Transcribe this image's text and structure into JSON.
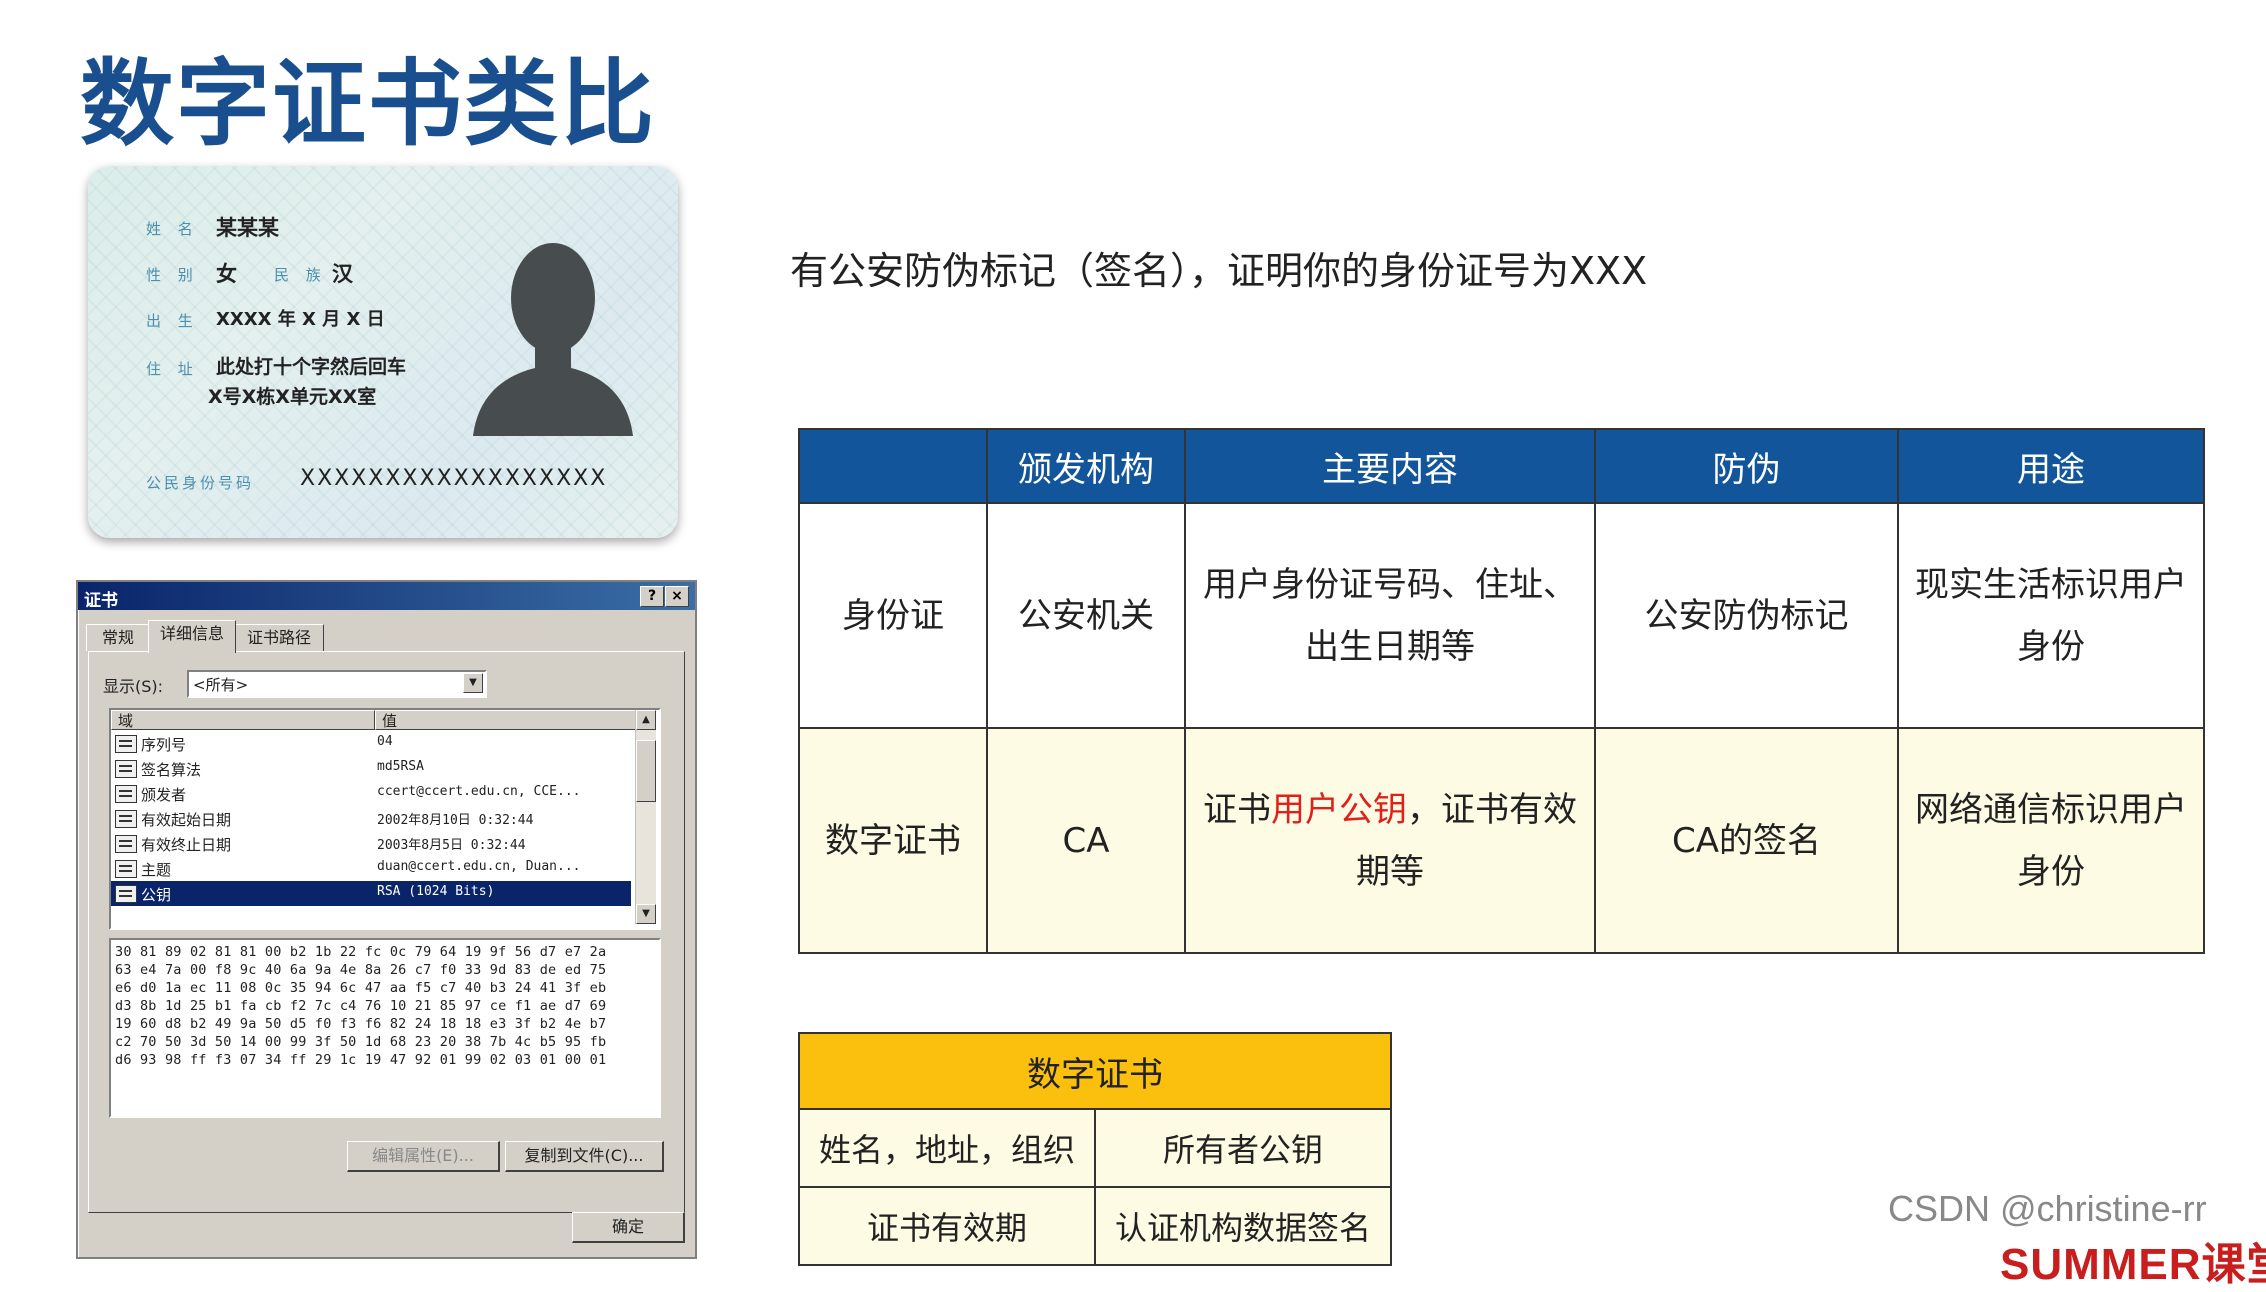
{
  "title": "数字证书类比",
  "id_card": {
    "name_label": "姓 名",
    "name_value": "某某某",
    "gender_label": "性 别",
    "gender_value": "女",
    "ethnicity_label": "民 族",
    "ethnicity_value": "汉",
    "birth_label": "出 生",
    "birth_value": "XXXX 年 X 月 X 日",
    "address_label": "住 址",
    "address_line1": "此处打十个字然后回车",
    "address_line2": "X号X栋X单元XX室",
    "id_number_label": "公民身份号码",
    "id_number_value": "XXXXXXXXXXXXXXXXXX"
  },
  "cert_dialog": {
    "title": "证书",
    "help_btn": "?",
    "close_btn": "×",
    "tabs": [
      "常规",
      "详细信息",
      "证书路径"
    ],
    "show_label": "显示(S):",
    "show_value": "<所有>",
    "col_field": "域",
    "col_value": "值",
    "rows": [
      {
        "field": "序列号",
        "value": "04"
      },
      {
        "field": "签名算法",
        "value": "md5RSA"
      },
      {
        "field": "颁发者",
        "value": "ccert@ccert.edu.cn, CCE..."
      },
      {
        "field": "有效起始日期",
        "value": "2002年8月10日 0:32:44"
      },
      {
        "field": "有效终止日期",
        "value": "2003年8月5日 0:32:44"
      },
      {
        "field": "主题",
        "value": "duan@ccert.edu.cn, Duan..."
      },
      {
        "field": "公钥",
        "value": "RSA (1024 Bits)"
      }
    ],
    "hex_lines": [
      "30 81 89 02 81 81 00 b2 1b 22 fc 0c 79 64 19 9f 56 d7 e7 2a",
      "63 e4 7a 00 f8 9c 40 6a 9a 4e 8a 26 c7 f0 33 9d 83 de ed 75",
      "e6 d0 1a ec 11 08 0c 35 94 6c 47 aa f5 c7 40 b3 24 41 3f eb",
      "d3 8b 1d 25 b1 fa cb f2 7c c4 76 10 21 85 97 ce f1 ae d7 69",
      "19 60 d8 b2 49 9a 50 d5 f0 f3 f6 82 24 18 18 e3 3f b2 4e b7",
      "c2 70 50 3d 50 14 00 99 3f 50 1d 68 23 20 38 7b 4c b5 95 fb",
      "d6 93 98 ff f3 07 34 ff 29 1c 19 47 92 01 99 02 03 01 00 01"
    ],
    "edit_btn": "编辑属性(E)...",
    "copy_btn": "复制到文件(C)...",
    "ok_btn": "确定"
  },
  "claim_text": "有公安防伪标记（签名），证明你的身份证号为XXX",
  "compare_table": {
    "headers": [
      "",
      "颁发机构",
      "主要内容",
      "防伪",
      "用途"
    ],
    "row1": {
      "name": "身份证",
      "issuer": "公安机关",
      "content": "用户身份证号码、住址、出生日期等",
      "security": "公安防伪标记",
      "usage": "现实生活标识用户身份"
    },
    "row2": {
      "name": "数字证书",
      "issuer": "CA",
      "content_pre": "证书",
      "content_red": "用户公钥",
      "content_post": "，证书有效期等",
      "security": "CA的签名",
      "usage": "网络通信标识用户身份"
    }
  },
  "small_table": {
    "header": "数字证书",
    "r1c1": "姓名，地址，组织",
    "r1c2": "所有者公钥",
    "r2c1": "证书有效期",
    "r2c2": "认证机构数据签名"
  },
  "watermark": "CSDN @christine-rr",
  "brand": "SUMMER课堂",
  "colors": {
    "title_blue": "#1a4f8f",
    "table_header_blue": "#13559b",
    "highlight_red": "#e0201c",
    "small_header_yellow": "#fbbf0e"
  }
}
